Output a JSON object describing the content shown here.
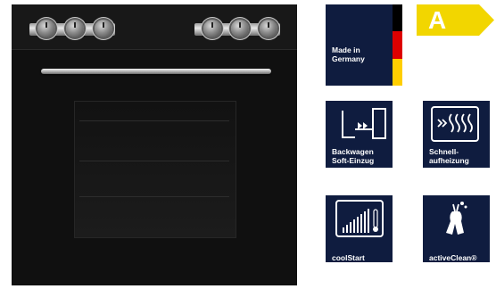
{
  "oven": {
    "display_text": "",
    "brand_text": ""
  },
  "badges": {
    "made_in": "Made in Germany",
    "energy_class": "A",
    "flag_colors": [
      "#000000",
      "#dd0000",
      "#ffce00"
    ],
    "energy_color": "#f2d600"
  },
  "features": [
    {
      "label": "Backwagen Soft-Einzug",
      "icon": "soft-close-drawer-icon"
    },
    {
      "label": "Schnell-aufheizung",
      "icon": "fast-heating-icon"
    },
    {
      "label": "coolStart",
      "icon": "coolstart-icon"
    },
    {
      "label": "activeClean®",
      "icon": "active-clean-icon"
    }
  ]
}
